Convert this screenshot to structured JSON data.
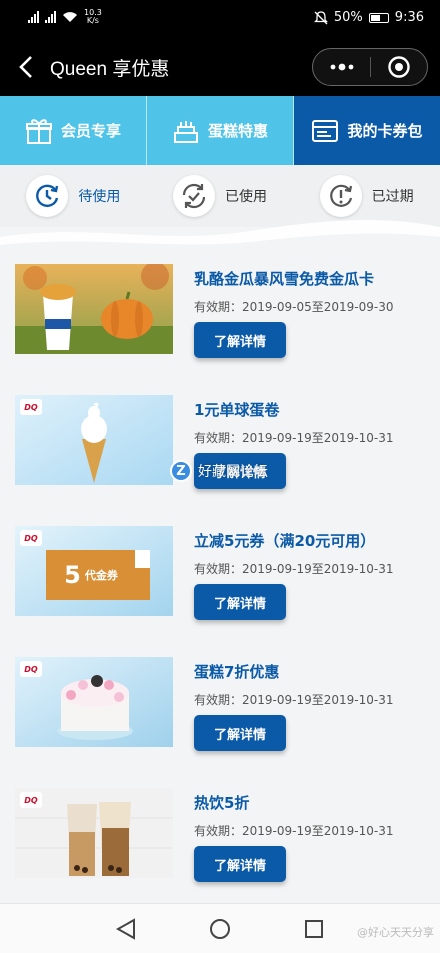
{
  "status_bar": {
    "network_speed": "10.3",
    "network_unit": "K/s",
    "battery": "50%",
    "time": "9:36",
    "signal_labels": [
      "4G",
      "4G"
    ]
  },
  "header": {
    "title": "Queen 享优惠",
    "more_icon": "more-dots-icon",
    "close_icon": "target-close-icon"
  },
  "category_tabs": [
    {
      "label": "会员专享",
      "icon": "gift-icon",
      "active": false
    },
    {
      "label": "蛋糕特惠",
      "icon": "cake-icon",
      "active": false
    },
    {
      "label": "我的卡券包",
      "icon": "card-icon",
      "active": true
    }
  ],
  "status_tabs": [
    {
      "label": "待使用",
      "icon": "clock-pending-icon"
    },
    {
      "label": "已使用",
      "icon": "refresh-check-icon"
    },
    {
      "label": "已过期",
      "icon": "clock-alert-icon"
    }
  ],
  "coupons": [
    {
      "name": "乳酪金瓜暴风雪免费金瓜卡",
      "date": "有效期：2019-09-05至2019-09-30",
      "button": "了解详情",
      "thumb": "blizzard",
      "dq_logo": "DQ"
    },
    {
      "name": "1元单球蛋卷",
      "date": "有效期：2019-09-19至2019-10-31",
      "button": "了解详情",
      "thumb": "cone",
      "dq_logo": "DQ"
    },
    {
      "name": "立减5元券（满20元可用）",
      "date": "有效期：2019-09-19至2019-10-31",
      "button": "了解详情",
      "thumb": "voucher",
      "voucher_text": "5",
      "voucher_sub": "代金券",
      "dq_logo": "DQ"
    },
    {
      "name": "蛋糕7折优惠",
      "date": "有效期：2019-09-19至2019-10-31",
      "button": "了解详情",
      "thumb": "cake",
      "dq_logo": "DQ"
    },
    {
      "name": "热饮5折",
      "date": "有效期：2019-09-19至2019-10-31",
      "button": "了解详情",
      "thumb": "drinks",
      "dq_logo": "DQ"
    }
  ],
  "watermark": {
    "text": "好藏网论坛",
    "icon_letter": "Z"
  },
  "nav": {
    "weibo_credit": "@好心天天分享"
  },
  "colors": {
    "accent": "#0b5aa8",
    "tab_light": "#4fc3e8",
    "title_bg": "#000000"
  }
}
